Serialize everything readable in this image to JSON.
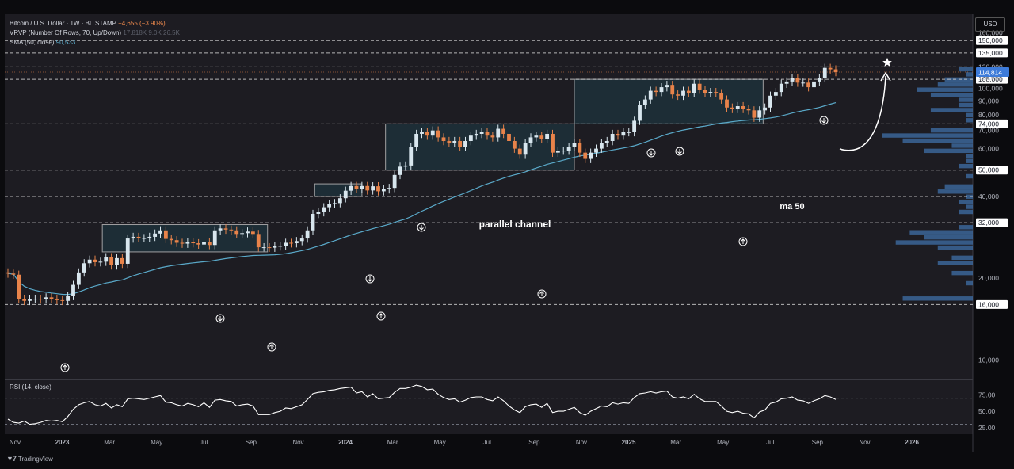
{
  "legend": {
    "symbol_line": "Bitcoin / U.S. Dollar · 1W · BITSTAMP",
    "change": "−4,655 (−3.90%)",
    "vrvp_line": "VRVP (Number Of Rows, 70, Up/Down)",
    "vrvp_values": "17.818K  9.0K  26.5K",
    "sma_line": "SMA (50, close)",
    "sma_value": "90,533"
  },
  "currency_button": "USD",
  "rsi_label": "RSI (14, close)",
  "brand": "TradingView",
  "colors": {
    "up": "#d8e6ee",
    "down": "#e8834a",
    "sma": "#5aa9c9",
    "rsi": "#ffffff",
    "channel_fill": "#1e3742",
    "volume_profile": "#3f6fa8"
  },
  "chart_data": {
    "type": "candlestick",
    "title": "Bitcoin / U.S. Dollar · 1W · BITSTAMP",
    "price_axis": {
      "scale": "log",
      "ticks": [
        10000,
        16000,
        20000,
        32000,
        40000,
        50000,
        60000,
        70000,
        74000,
        80000,
        90000,
        100000,
        108000,
        110000,
        120000,
        135000,
        150000,
        160000
      ],
      "tick_labels": [
        "10,000",
        "16,000",
        "20,000",
        "32,000",
        "40,000",
        "50,000",
        "60,000",
        "70,000",
        "74,000",
        "80,000",
        "90,000",
        "100,000",
        "108,000",
        "110,000",
        "120,000",
        "135,000",
        "150,000",
        "160,000"
      ],
      "highlighted": [
        "16,000",
        "32,000",
        "50,000",
        "74,000",
        "108,000",
        "135,000",
        "150,000"
      ],
      "current_price": 114814,
      "current_price_label": "114,814"
    },
    "time_axis": {
      "labels": [
        "Nov",
        "2023",
        "Mar",
        "May",
        "Jul",
        "Sep",
        "Nov",
        "2024",
        "Mar",
        "May",
        "Jul",
        "Sep",
        "Nov",
        "2025",
        "Mar",
        "May",
        "Jul",
        "Sep",
        "Nov",
        "2026"
      ],
      "bold": [
        "2023",
        "2024",
        "2025",
        "2026"
      ]
    },
    "horizontal_levels": [
      16000,
      32000,
      40000,
      50000,
      74000,
      108000,
      120000,
      135000,
      150000
    ],
    "annotations": [
      {
        "text": "parallel channel",
        "type": "label"
      },
      {
        "text": "ma 50",
        "type": "label"
      }
    ],
    "channels": [
      {
        "from": "2023-03",
        "to": "2023-10",
        "low": 25000,
        "high": 31500
      },
      {
        "from": "2023-12",
        "to": "2024-02",
        "low": 40000,
        "high": 44500
      },
      {
        "from": "2024-03",
        "to": "2024-11",
        "low": 50000,
        "high": 74000
      },
      {
        "from": "2024-11",
        "to": "2025-07",
        "low": 74000,
        "high": 108000
      }
    ],
    "series": [
      {
        "name": "close",
        "note": "weekly closes",
        "values": [
          20800,
          20600,
          16800,
          16500,
          16800,
          16800,
          16700,
          17000,
          16800,
          16600,
          16500,
          17200,
          18900,
          21000,
          22700,
          23400,
          22900,
          23000,
          23900,
          22300,
          23700,
          22600,
          28000,
          28400,
          28100,
          28100,
          28400,
          29200,
          30000,
          27900,
          27600,
          27000,
          26800,
          27100,
          26900,
          26600,
          27200,
          26500,
          30000,
          30500,
          30200,
          30000,
          29100,
          29300,
          29700,
          29100,
          26000,
          26000,
          25900,
          26200,
          26300,
          27000,
          26900,
          27400,
          28000,
          30000,
          34500,
          35000,
          36500,
          37500,
          37800,
          39400,
          42000,
          43700,
          42600,
          43700,
          42100,
          43600,
          41800,
          42500,
          43000,
          48000,
          51500,
          52000,
          61000,
          68000,
          69000,
          67000,
          70000,
          66000,
          64000,
          63000,
          64000,
          61000,
          64000,
          67000,
          68000,
          69000,
          67000,
          66000,
          71000,
          68000,
          64000,
          60000,
          57000,
          63000,
          66000,
          67000,
          65000,
          68000,
          58000,
          59000,
          59000,
          61000,
          63000,
          58000,
          55000,
          58000,
          60000,
          63000,
          64000,
          68000,
          67000,
          69000,
          69000,
          76000,
          87000,
          91000,
          98000,
          97000,
          101000,
          103000,
          95000,
          94000,
          98000,
          96000,
          104000,
          99000,
          96000,
          97000,
          96000,
          91000,
          85000,
          84000,
          86000,
          84000,
          83000,
          78000,
          83000,
          85000,
          94000,
          97000,
          104000,
          106000,
          109000,
          105000,
          105000,
          101000,
          106000,
          109000,
          119000,
          117500,
          114814
        ]
      },
      {
        "name": "SMA (50, close)",
        "last_value": 90533
      }
    ],
    "rsi": {
      "label": "RSI (14, close)",
      "ticks": [
        25,
        50,
        75
      ],
      "tick_labels": [
        "25.00",
        "50.00",
        "75.00"
      ],
      "levels": [
        30,
        70
      ],
      "values": [
        38,
        33,
        32,
        35,
        30,
        31,
        33,
        36,
        35,
        36,
        34,
        42,
        53,
        60,
        63,
        65,
        60,
        58,
        62,
        55,
        60,
        57,
        69,
        70,
        69,
        68,
        70,
        72,
        74,
        64,
        63,
        60,
        58,
        62,
        60,
        57,
        63,
        56,
        67,
        68,
        66,
        65,
        58,
        60,
        61,
        58,
        45,
        45,
        45,
        48,
        50,
        55,
        54,
        57,
        60,
        68,
        77,
        79,
        80,
        82,
        83,
        85,
        86,
        87,
        78,
        80,
        72,
        77,
        69,
        70,
        71,
        79,
        85,
        85,
        87,
        90,
        88,
        83,
        84,
        76,
        71,
        68,
        69,
        64,
        67,
        71,
        72,
        72,
        68,
        66,
        72,
        66,
        58,
        52,
        48,
        57,
        60,
        61,
        56,
        62,
        48,
        50,
        50,
        53,
        56,
        48,
        44,
        50,
        54,
        58,
        57,
        63,
        61,
        63,
        62,
        71,
        77,
        78,
        80,
        78,
        80,
        81,
        72,
        70,
        72,
        69,
        76,
        69,
        65,
        65,
        65,
        58,
        50,
        48,
        50,
        47,
        46,
        40,
        49,
        52,
        62,
        64,
        69,
        70,
        72,
        67,
        66,
        62,
        66,
        69,
        74,
        72,
        68
      ]
    }
  }
}
